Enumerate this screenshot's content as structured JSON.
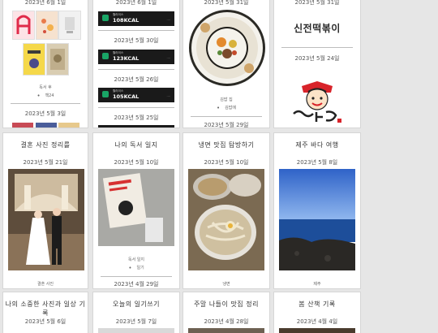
{
  "row1": {
    "col1": {
      "date_top": "2023년 6월 1일",
      "caption": "독서 후",
      "bullet": "책24",
      "date_bottom": "2023년 5월 3일"
    },
    "col2": {
      "date_top": "2023년 6월 1일",
      "items": [
        {
          "brand": "월라이스",
          "kcal": "108KCAL"
        },
        {
          "brand": "월라이스",
          "kcal": "123KCAL"
        },
        {
          "brand": "월라이스",
          "kcal": "105KCAL"
        }
      ],
      "dates": [
        "2023년 5월 30일",
        "2023년 5월 26일",
        "2023년 5월 25일"
      ]
    },
    "col3": {
      "date_top": "2023년 5월 31일",
      "caption": "김밥 집",
      "bullet": "김밥에",
      "date_bottom": "2023년 5월 29일"
    },
    "col4": {
      "date_top": "2023년 5월 31일",
      "logo_text": "신전떡볶이",
      "date_mid": "2023년 5월 24일"
    }
  },
  "row2": [
    {
      "title": "결혼 사진 정리를",
      "date": "2023년 5월 21일",
      "caption": "결혼 사진"
    },
    {
      "title": "나의 독서 일지",
      "date": "2023년 5월 10일",
      "caption": "독서 일지",
      "bullet": "일기",
      "date_bottom": "2023년 4월 29일"
    },
    {
      "title": "냉면 맛집 탐방하기",
      "date": "2023년 5월 10일",
      "caption": "냉면"
    },
    {
      "title": "제주 바다 여행",
      "date": "2023년 5월 8일",
      "caption": "제주"
    }
  ],
  "row3": [
    {
      "title": "나의 소중한 사진과 일상 기록",
      "date": "2023년 5월 6일"
    },
    {
      "title": "오늘의 일기쓰기",
      "date": "2023년 5월 7일"
    },
    {
      "title": "주말 나들이 맛집 정리",
      "date": "2023년 4월 28일"
    },
    {
      "title": "봄 산책 기록",
      "date": "2023년 4월 4일"
    }
  ],
  "colors": {
    "background": "#e6e6e6",
    "card": "#ffffff",
    "kcal_bar": "#1a1a1a",
    "kcal_icon": "#19a566"
  }
}
